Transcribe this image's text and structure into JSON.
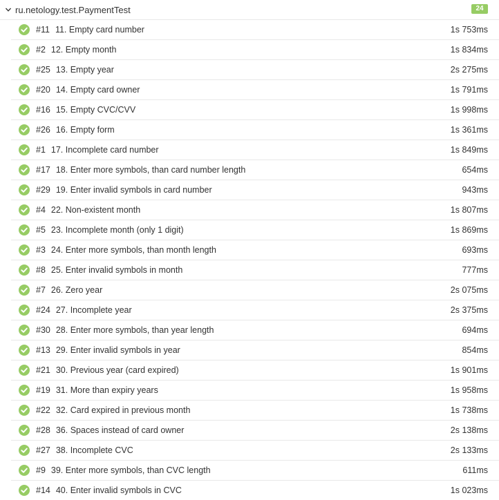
{
  "suite": {
    "title": "ru.netology.test.PaymentTest",
    "count": "24",
    "badge_color": "#97cc64",
    "status_color": "#97cc64",
    "chevron_icon": "chevron-down-icon",
    "status_icon": "check-circle-icon"
  },
  "tests": [
    {
      "order": "#11",
      "name": "11. Empty card number",
      "duration": "1s 753ms"
    },
    {
      "order": "#2",
      "name": "12. Empty month",
      "duration": "1s 834ms"
    },
    {
      "order": "#25",
      "name": "13. Empty year",
      "duration": "2s 275ms"
    },
    {
      "order": "#20",
      "name": "14. Empty card owner",
      "duration": "1s 791ms"
    },
    {
      "order": "#16",
      "name": "15. Empty CVC/CVV",
      "duration": "1s 998ms"
    },
    {
      "order": "#26",
      "name": "16. Empty form",
      "duration": "1s 361ms"
    },
    {
      "order": "#1",
      "name": "17. Incomplete card number",
      "duration": "1s 849ms"
    },
    {
      "order": "#17",
      "name": "18. Enter more symbols, than card number length",
      "duration": "654ms"
    },
    {
      "order": "#29",
      "name": "19. Enter invalid symbols in card number",
      "duration": "943ms"
    },
    {
      "order": "#4",
      "name": "22. Non-existent month",
      "duration": "1s 807ms"
    },
    {
      "order": "#5",
      "name": "23. Incomplete month (only 1 digit)",
      "duration": "1s 869ms"
    },
    {
      "order": "#3",
      "name": "24. Enter more symbols, than month length",
      "duration": "693ms"
    },
    {
      "order": "#8",
      "name": "25. Enter invalid symbols in month",
      "duration": "777ms"
    },
    {
      "order": "#7",
      "name": "26. Zero year",
      "duration": "2s 075ms"
    },
    {
      "order": "#24",
      "name": "27. Incomplete year",
      "duration": "2s 375ms"
    },
    {
      "order": "#30",
      "name": "28. Enter more symbols, than year length",
      "duration": "694ms"
    },
    {
      "order": "#13",
      "name": "29. Enter invalid symbols in year",
      "duration": "854ms"
    },
    {
      "order": "#21",
      "name": "30. Previous year (card expired)",
      "duration": "1s 901ms"
    },
    {
      "order": "#19",
      "name": "31. More than expiry years",
      "duration": "1s 958ms"
    },
    {
      "order": "#22",
      "name": "32. Card expired in previous month",
      "duration": "1s 738ms"
    },
    {
      "order": "#28",
      "name": "36. Spaces instead of card owner",
      "duration": "2s 138ms"
    },
    {
      "order": "#27",
      "name": "38. Incomplete CVC",
      "duration": "2s 133ms"
    },
    {
      "order": "#9",
      "name": "39. Enter more symbols, than CVC length",
      "duration": "611ms"
    },
    {
      "order": "#14",
      "name": "40. Enter invalid symbols in CVC",
      "duration": "1s 023ms"
    }
  ]
}
